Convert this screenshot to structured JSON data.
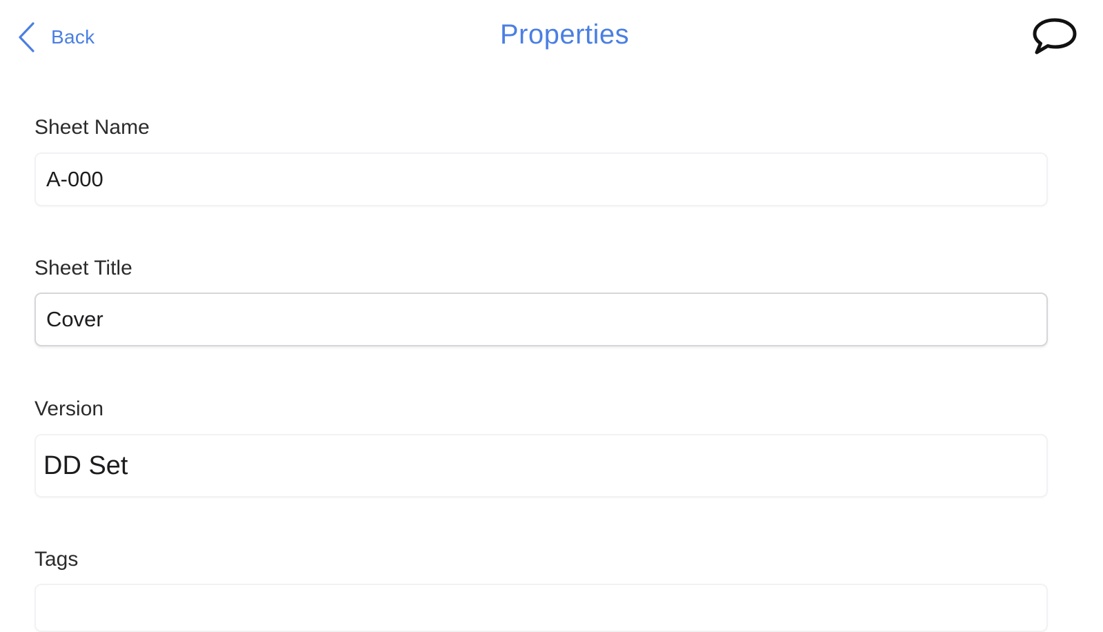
{
  "nav": {
    "back_label": "Back",
    "title": "Properties",
    "comment_icon": "speech-bubble-icon",
    "accent_color": "#4a7fe3"
  },
  "form": {
    "sheet_name": {
      "label": "Sheet Name",
      "value": "A-000"
    },
    "sheet_title": {
      "label": "Sheet Title",
      "value": "Cover"
    },
    "version": {
      "label": "Version",
      "value": "DD Set"
    },
    "tags": {
      "label": "Tags",
      "value": ""
    }
  }
}
